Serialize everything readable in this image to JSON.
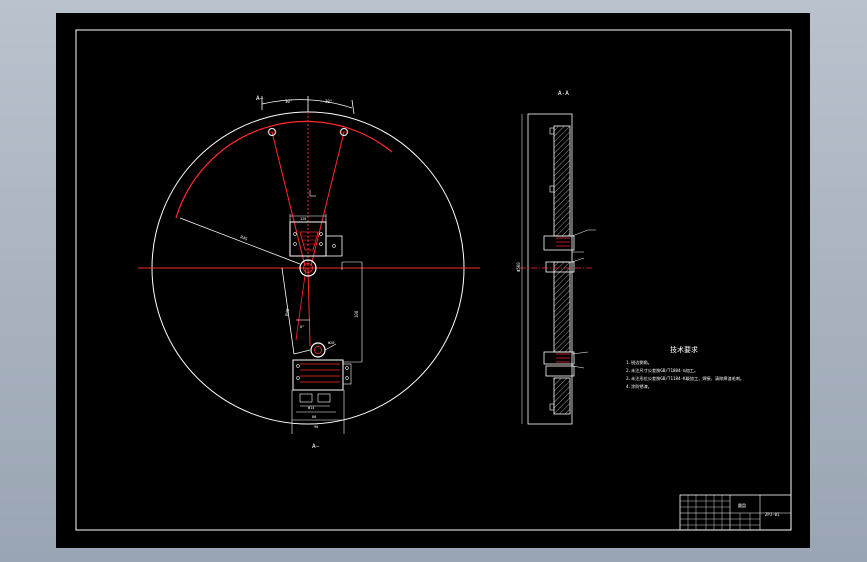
{
  "drawing": {
    "section_label_top": "A—",
    "section_label_bottom": "A—",
    "side_view_label": "A-A",
    "notes": {
      "title": "技术要求",
      "items": [
        "1.锐边倒角。",
        "2.未注尺寸公差按GB/T1804-m加工。",
        "3.未注形位公差按GB/T1184-K级加工，焊接，清除焊渣毛刺。",
        "4.涂防锈漆。"
      ]
    },
    "title_block": {
      "part_name": "圆盘",
      "drawing_no": "ZPJ-01"
    }
  },
  "colors": {
    "line_white": "#ffffff",
    "line_red": "#ff2a2a",
    "sheet_bg": "#000000",
    "window_bg": "#a9b3c1"
  }
}
